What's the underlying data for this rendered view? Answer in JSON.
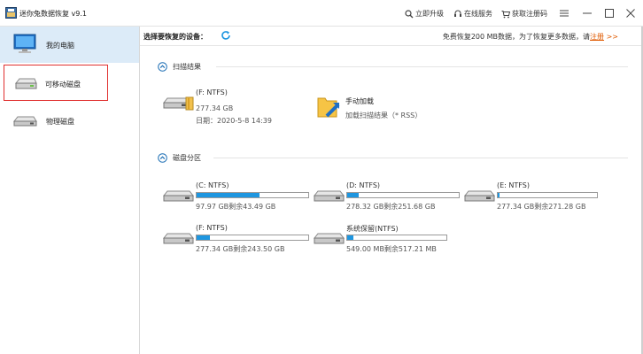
{
  "window": {
    "title": "迷你兔数据恢复 v9.1",
    "links": {
      "upgrade": "立即升级",
      "online_service": "在线服务",
      "get_code": "获取注册码"
    }
  },
  "sidebar": {
    "items": [
      {
        "label": "我的电脑"
      },
      {
        "label": "可移动磁盘"
      },
      {
        "label": "物理磁盘"
      }
    ]
  },
  "toolbar": {
    "select_label": "选择要恢复的设备：",
    "promo_text": "免费恢复200 MB数据，为了恢复更多数据，请",
    "promo_link": "注册",
    "promo_arrow": ">>"
  },
  "scan_results": {
    "title": "扫描结果",
    "drive": {
      "name": "(F: NTFS)",
      "size": "277.34 GB",
      "date": "日期：2020-5-8 14:39"
    },
    "manual_load": {
      "title": "手动加载",
      "desc": "加载扫描结果（* RSS）"
    }
  },
  "partitions": {
    "title": "磁盘分区",
    "items": [
      {
        "name": "(C: NTFS)",
        "usage": "97.97 GB剩余43.49 GB",
        "used_fraction": 0.56
      },
      {
        "name": "(D: NTFS)",
        "usage": "278.32 GB剩余251.68 GB",
        "used_fraction": 0.1
      },
      {
        "name": "(E: NTFS)",
        "usage": "277.34 GB剩余271.28 GB",
        "used_fraction": 0.02
      },
      {
        "name": "(F: NTFS)",
        "usage": "277.34 GB剩余243.50 GB",
        "used_fraction": 0.12
      },
      {
        "name": "系统保留(NTFS)",
        "usage": "549.00 MB剩余517.21 MB",
        "used_fraction": 0.06
      }
    ]
  },
  "colors": {
    "accent": "#1e96e0",
    "selected_bg": "#dcebf8",
    "highlight_border": "#e0302f",
    "promo_link": "#e05a00"
  }
}
